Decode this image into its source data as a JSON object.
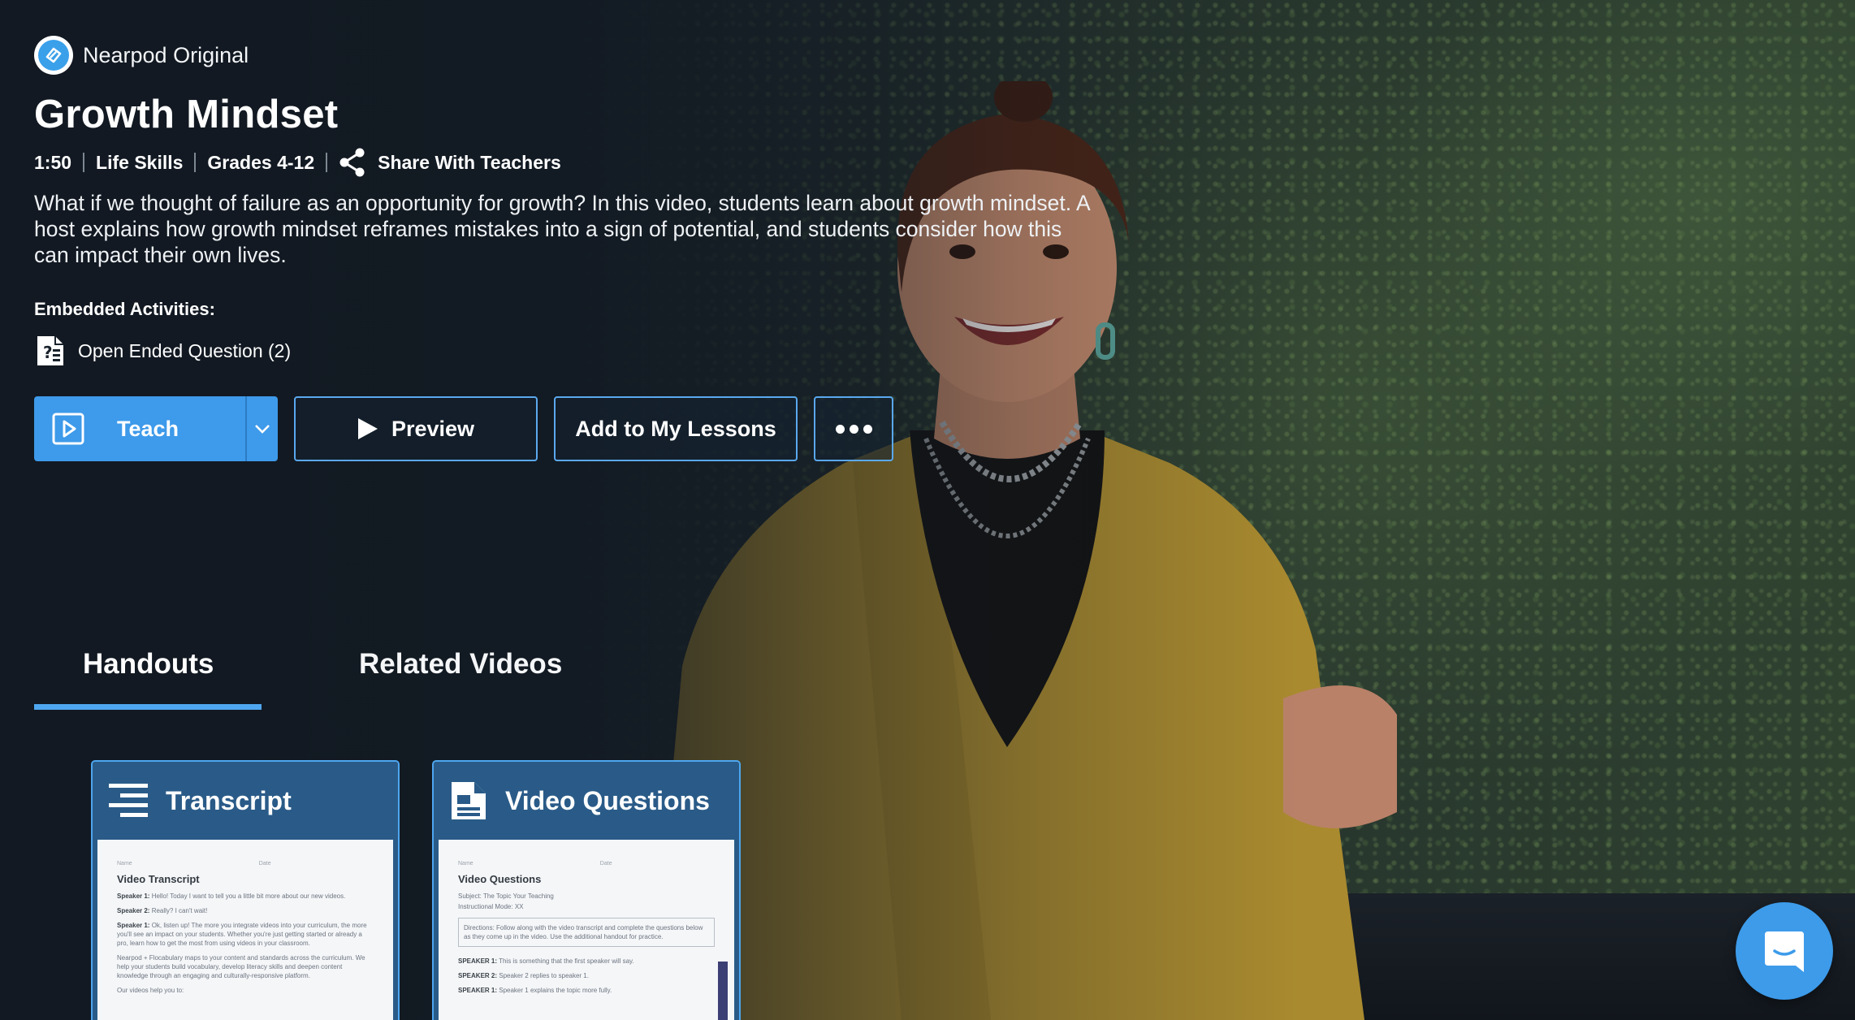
{
  "brand": {
    "label": "Nearpod Original",
    "logo_icon": "nearpod-logo-icon"
  },
  "video": {
    "title": "Growth Mindset",
    "duration": "1:50",
    "subject": "Life Skills",
    "grades": "Grades 4-12",
    "share_label": "Share With Teachers",
    "description": "What if we thought of failure as an opportunity for growth? In this video, students learn about growth mindset. A host explains how growth mindset reframes mistakes into a sign of potential, and students consider how this can impact their own lives."
  },
  "embedded": {
    "label": "Embedded Activities:",
    "items": [
      {
        "label": "Open Ended Question (2)",
        "icon": "question-document-icon"
      }
    ]
  },
  "actions": {
    "teach_label": "Teach",
    "preview_label": "Preview",
    "add_label": "Add to My Lessons",
    "more_icon": "more-dots-icon"
  },
  "tabs": [
    {
      "label": "Handouts",
      "active": true
    },
    {
      "label": "Related Videos",
      "active": false
    }
  ],
  "handouts": [
    {
      "title": "Transcript",
      "icon": "lines-icon",
      "doc": {
        "name_label": "Name",
        "date_label": "Date",
        "heading": "Video Transcript",
        "lines": [
          {
            "speaker": "Speaker 1:",
            "text": "Hello! Today I want to tell you a little bit more about our new videos."
          },
          {
            "speaker": "Speaker 2:",
            "text": "Really? I can't wait!"
          },
          {
            "speaker": "Speaker 1:",
            "text": "Ok, listen up! The more you integrate videos into your curriculum, the more you'll see an impact on your students. Whether you're just getting started or already a pro, learn how to get the most from using videos in your classroom."
          },
          {
            "speaker": "",
            "text": "Nearpod + Flocabulary maps to your content and standards across the curriculum. We help your students build vocabulary, develop literacy skills and deepen content knowledge through an engaging and culturally-responsive platform."
          },
          {
            "speaker": "",
            "text": "Our videos help you to:"
          }
        ]
      }
    },
    {
      "title": "Video Questions",
      "icon": "document-icon",
      "doc": {
        "name_label": "Name",
        "date_label": "Date",
        "heading": "Video Questions",
        "subject_line": "Subject: The Topic Your Teaching",
        "mode_line": "Instructional Mode: XX",
        "directions": "Directions: Follow along with the video transcript and complete the questions below as they come up in the video. Use the additional handout for practice.",
        "lines": [
          {
            "speaker": "SPEAKER 1:",
            "text": "This is something that the first speaker will say."
          },
          {
            "speaker": "SPEAKER 2:",
            "text": "Speaker 2 replies to speaker 1."
          },
          {
            "speaker": "SPEAKER 1:",
            "text": "Speaker 1 explains the topic more fully."
          }
        ]
      }
    }
  ],
  "chat": {
    "icon": "chat-icon"
  },
  "colors": {
    "accent": "#3e9aea",
    "card": "#2a5b88",
    "background": "#151d25"
  }
}
